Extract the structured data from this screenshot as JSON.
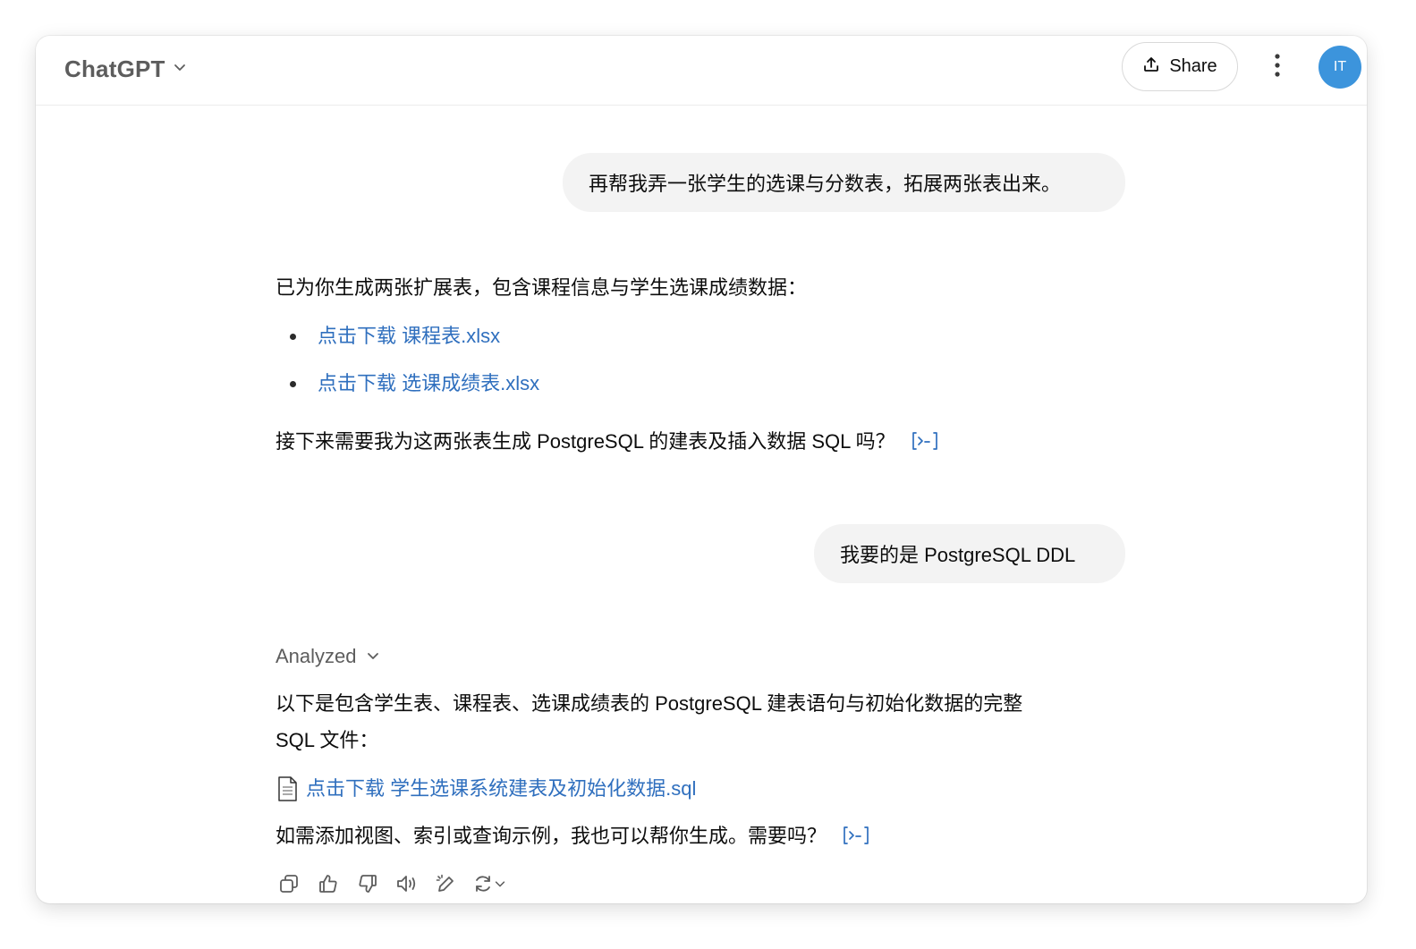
{
  "header": {
    "model_name": "ChatGPT",
    "share_label": "Share",
    "avatar_initials": "IT"
  },
  "messages": {
    "user1": "再帮我弄一张学生的选课与分数表，拓展两张表出来。",
    "assistant1": {
      "intro": "已为你生成两张扩展表，包含课程信息与学生选课成绩数据：",
      "links": [
        "点击下载 课程表.xlsx",
        "点击下载 选课成绩表.xlsx"
      ],
      "followup": "接下来需要我为这两张表生成 PostgreSQL 的建表及插入数据 SQL 吗？"
    },
    "user2": "我要的是 PostgreSQL DDL",
    "assistant2": {
      "analyzed_label": "Analyzed",
      "intro_line1": "以下是包含学生表、课程表、选课成绩表的 PostgreSQL 建表语句与初始化数据的完整",
      "intro_line2": "SQL 文件：",
      "file_link": "点击下载 学生选课系统建表及初始化数据.sql",
      "followup": "如需添加视图、索引或查询示例，我也可以帮你生成。需要吗？"
    }
  },
  "colors": {
    "link": "#2f6fbe",
    "avatar": "#3c94dc",
    "bubble": "#f3f3f3"
  },
  "icons": [
    "chevron-down-icon",
    "share-icon",
    "more-vertical-icon",
    "citation-icon",
    "file-icon",
    "copy-icon",
    "thumbs-up-icon",
    "thumbs-down-icon",
    "read-aloud-icon",
    "edit-icon",
    "regenerate-icon"
  ]
}
